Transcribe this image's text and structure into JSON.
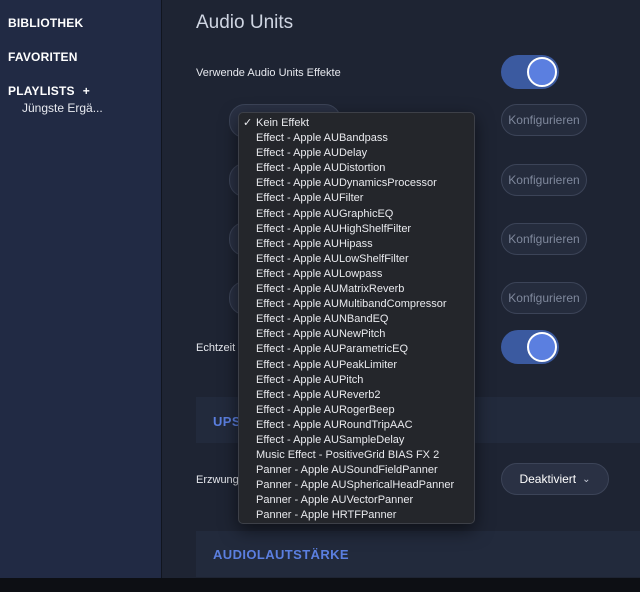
{
  "sidebar": {
    "library": "BIBLIOTHEK",
    "favorites": "FAVORITEN",
    "playlists": "PLAYLISTS",
    "playlists_add": "+",
    "playlist_items": [
      "Jüngste Ergä..."
    ]
  },
  "main": {
    "title": "Audio Units",
    "use_au_effects_label": "Verwende Audio Units Effekte",
    "use_au_effects_on": true,
    "configure_label": "Konfigurieren",
    "realtime_label": "Echtzeit",
    "realtime_on": true,
    "upsampling_section": "UPS",
    "force_label": "Erzwung",
    "deactivated_label": "Deaktiviert",
    "volume_section": "AUDIOLAUTSTÄRKE"
  },
  "menu": {
    "selected": "Kein Effekt",
    "checkmark": "✓",
    "items": [
      "Kein Effekt",
      "Effect - Apple AUBandpass",
      "Effect - Apple AUDelay",
      "Effect - Apple AUDistortion",
      "Effect - Apple AUDynamicsProcessor",
      "Effect - Apple AUFilter",
      "Effect - Apple AUGraphicEQ",
      "Effect - Apple AUHighShelfFilter",
      "Effect - Apple AUHipass",
      "Effect - Apple AULowShelfFilter",
      "Effect - Apple AULowpass",
      "Effect - Apple AUMatrixReverb",
      "Effect - Apple AUMultibandCompressor",
      "Effect - Apple AUNBandEQ",
      "Effect - Apple AUNewPitch",
      "Effect - Apple AUParametricEQ",
      "Effect - Apple AUPeakLimiter",
      "Effect - Apple AUPitch",
      "Effect - Apple AUReverb2",
      "Effect - Apple AURogerBeep",
      "Effect - Apple AURoundTripAAC",
      "Effect - Apple AUSampleDelay",
      "Music Effect - PositiveGrid BIAS FX 2",
      "Panner - Apple AUSoundFieldPanner",
      "Panner - Apple AUSphericalHeadPanner",
      "Panner - Apple AUVectorPanner",
      "Panner - Apple HRTFPanner"
    ]
  },
  "colors": {
    "accent": "#5b7fe0",
    "toggle_track": "#3b5aa0",
    "sidebar_bg": "#212a44",
    "main_bg": "#1e2433",
    "menu_bg": "#24262b"
  }
}
